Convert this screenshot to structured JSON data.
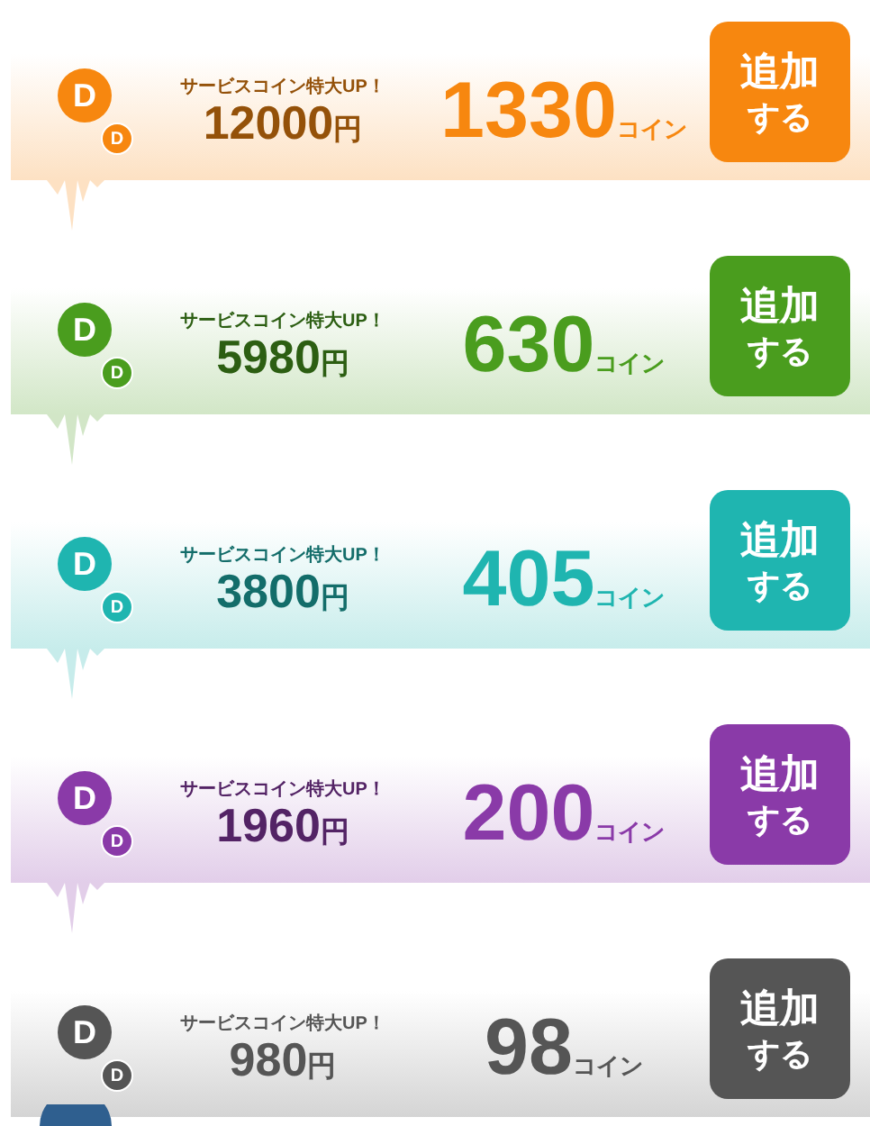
{
  "offers": [
    {
      "color": "#f7870f",
      "logo": [
        "D",
        "D"
      ],
      "tagline": "サービスコイン特大UP！",
      "price": "12000",
      "yen": "円",
      "coins": "1330",
      "coin_unit": "コイン",
      "button": [
        "追加",
        "する"
      ]
    },
    {
      "color": "#4a9d1e",
      "logo": [
        "D",
        "D"
      ],
      "tagline": "サービスコイン特大UP！",
      "price": "5980",
      "yen": "円",
      "coins": "630",
      "coin_unit": "コイン",
      "button": [
        "追加",
        "する"
      ]
    },
    {
      "color": "#1fb5b0",
      "logo": [
        "D",
        "D"
      ],
      "tagline": "サービスコイン特大UP！",
      "price": "3800",
      "yen": "円",
      "coins": "405",
      "coin_unit": "コイン",
      "button": [
        "追加",
        "する"
      ]
    },
    {
      "color": "#8a3aa8",
      "logo": [
        "D",
        "D"
      ],
      "tagline": "サービスコイン特大UP！",
      "price": "1960",
      "yen": "円",
      "coins": "200",
      "coin_unit": "コイン",
      "button": [
        "追加",
        "する"
      ]
    },
    {
      "color": "#555555",
      "logo": [
        "D",
        "D"
      ],
      "tagline": "サービスコイン特大UP！",
      "price": "980",
      "yen": "円",
      "coins": "98",
      "coin_unit": "コイン",
      "button": [
        "追加",
        "する"
      ]
    }
  ]
}
